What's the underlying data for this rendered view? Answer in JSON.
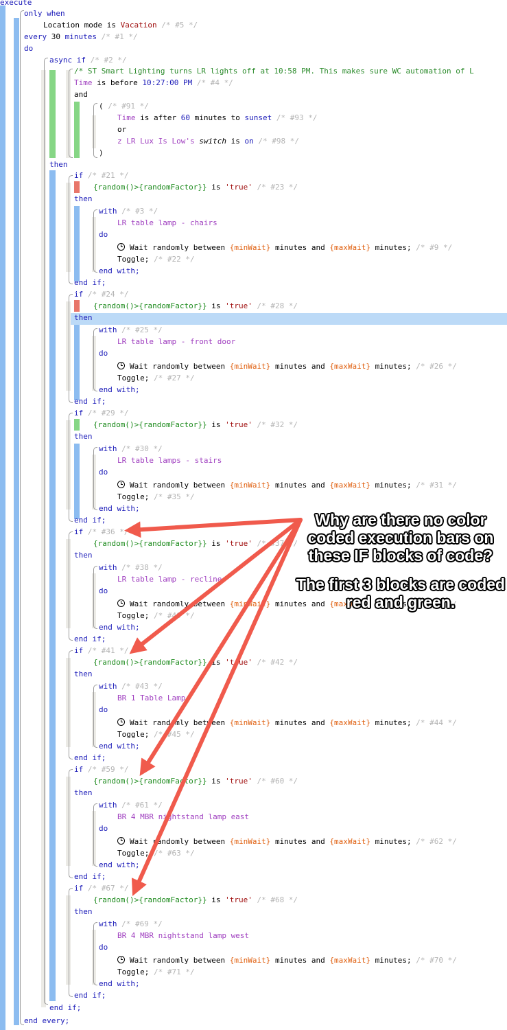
{
  "keywords": {
    "execute": "execute",
    "only_when": "only when",
    "do": "do",
    "async_if": "async if",
    "and": "and",
    "or": "or",
    "open_paren": "(",
    "close_paren": ")",
    "then": "then",
    "if": "if",
    "with": "with",
    "end_with": "end with;",
    "end_if": "end if;",
    "end_every": "end every;",
    "is": "is",
    "toggle": "Toggle;",
    "wait_a": "Wait randomly between",
    "wait_b": "minutes and",
    "wait_c": "minutes;",
    "min_wait": "{minWait}",
    "max_wait": "{maxWait}",
    "random_expr": "{random()>{randomFactor}}",
    "true_str": "'true'"
  },
  "piston": {
    "condition": {
      "key": "Location mode",
      "op": "is",
      "value": "Vacation",
      "comment": "/* #5 */"
    },
    "every": {
      "prefix": "every",
      "amount": "30",
      "unit": "minutes",
      "comment": "/* #1 */"
    },
    "async_comment": "/* #2 */",
    "note_comment": "/* ST Smart Lighting turns LR lights off at 10:58 PM. This makes sure WC automation of L",
    "time_condition": {
      "key": "Time",
      "op": "is before",
      "value": "10:27:00 PM",
      "comment": "/* #4 */"
    },
    "group_comment": "/* #91 */",
    "sunset_condition": {
      "key": "Time",
      "op": "is after",
      "amount": "60",
      "unit": "minutes to",
      "value": "sunset",
      "comment": "/* #93 */"
    },
    "switch_condition": {
      "device": "z LR Lux Is Low",
      "possessive": "'s",
      "attr": "switch",
      "op": "is",
      "value": "on",
      "comment": "/* #98 */"
    }
  },
  "if_blocks": [
    {
      "if_comment": "/* #21 */",
      "cond_comment": "/* #23 */",
      "with_comment": "/* #3 */",
      "device": "LR table lamp - chairs",
      "wait_comment": "/* #9 */",
      "toggle_comment": "/* #22 */",
      "status": "red"
    },
    {
      "if_comment": "/* #24 */",
      "cond_comment": "/* #28 */",
      "with_comment": "/* #25 */",
      "device": "LR table lamp - front door",
      "wait_comment": "/* #26 */",
      "toggle_comment": "/* #27 */",
      "status": "red"
    },
    {
      "if_comment": "/* #29 */",
      "cond_comment": "/* #32 */",
      "with_comment": "/* #30 */",
      "device": "LR table lamps - stairs",
      "wait_comment": "/* #31 */",
      "toggle_comment": "/* #35 */",
      "status": "green"
    },
    {
      "if_comment": "/* #36 */",
      "cond_comment": "/* #37 */",
      "with_comment": "/* #38 */",
      "device": "LR table lamp - recliner",
      "wait_comment": "/* #39 */",
      "toggle_comment": "/* #40 */",
      "status": "none"
    },
    {
      "if_comment": "/* #41 */",
      "cond_comment": "/* #42 */",
      "with_comment": "/* #43 */",
      "device": "BR 1 Table Lamp",
      "wait_comment": "/* #44 */",
      "toggle_comment": "/* #45 */",
      "status": "none"
    },
    {
      "if_comment": "/* #59 */",
      "cond_comment": "/* #60 */",
      "with_comment": "/* #61 */",
      "device": "BR 4 MBR nightstand lamp east",
      "wait_comment": "/* #62 */",
      "toggle_comment": "/* #63 */",
      "status": "none"
    },
    {
      "if_comment": "/* #67 */",
      "cond_comment": "/* #68 */",
      "with_comment": "/* #69 */",
      "device": "BR 4 MBR nightstand lamp west",
      "wait_comment": "/* #70 */",
      "toggle_comment": "/* #71 */",
      "status": "none"
    }
  ],
  "annotation": {
    "question": "Why are there no color coded execution bars on these IF blocks of code?",
    "note": "The first 3 blocks are coded red and green."
  },
  "colors": {
    "bar_blue": "#8cbcf0",
    "bar_green": "#86d685",
    "bar_red": "#e8766a",
    "bar_gray": "#ecebe6",
    "highlight": "#bcdaf7",
    "arrow": "#f05a4c"
  }
}
